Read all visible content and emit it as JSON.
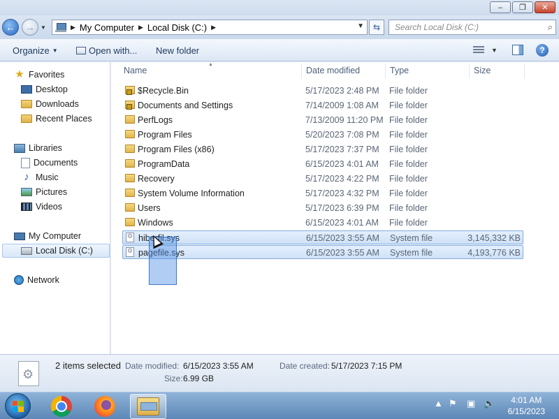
{
  "window": {
    "minimize_glyph": "–",
    "maximize_glyph": "❐",
    "close_glyph": "✕"
  },
  "address": {
    "crumbs": [
      "My Computer",
      "Local Disk (C:)"
    ],
    "search_placeholder": "Search Local Disk (C:)"
  },
  "toolbar": {
    "organize": "Organize",
    "open_with": "Open with...",
    "new_folder": "New folder"
  },
  "nav": {
    "favorites": "Favorites",
    "desktop": "Desktop",
    "downloads": "Downloads",
    "recent_places": "Recent Places",
    "libraries": "Libraries",
    "documents": "Documents",
    "music": "Music",
    "pictures": "Pictures",
    "videos": "Videos",
    "my_computer": "My Computer",
    "local_disk": "Local Disk (C:)",
    "network": "Network"
  },
  "columns": {
    "name": "Name",
    "date_modified": "Date modified",
    "type": "Type",
    "size": "Size"
  },
  "files": [
    {
      "name": "$Recycle.Bin",
      "date": "5/17/2023 2:48 PM",
      "type": "File folder",
      "size": "",
      "icon": "locked-folder",
      "selected": false
    },
    {
      "name": "Documents and Settings",
      "date": "7/14/2009 1:08 AM",
      "type": "File folder",
      "size": "",
      "icon": "locked-folder",
      "selected": false
    },
    {
      "name": "PerfLogs",
      "date": "7/13/2009 11:20 PM",
      "type": "File folder",
      "size": "",
      "icon": "folder",
      "selected": false
    },
    {
      "name": "Program Files",
      "date": "5/20/2023 7:08 PM",
      "type": "File folder",
      "size": "",
      "icon": "folder",
      "selected": false
    },
    {
      "name": "Program Files (x86)",
      "date": "5/17/2023 7:37 PM",
      "type": "File folder",
      "size": "",
      "icon": "folder",
      "selected": false
    },
    {
      "name": "ProgramData",
      "date": "6/15/2023 4:01 AM",
      "type": "File folder",
      "size": "",
      "icon": "folder",
      "selected": false
    },
    {
      "name": "Recovery",
      "date": "5/17/2023 4:22 PM",
      "type": "File folder",
      "size": "",
      "icon": "folder",
      "selected": false
    },
    {
      "name": "System Volume Information",
      "date": "5/17/2023 4:32 PM",
      "type": "File folder",
      "size": "",
      "icon": "folder",
      "selected": false
    },
    {
      "name": "Users",
      "date": "5/17/2023 6:39 PM",
      "type": "File folder",
      "size": "",
      "icon": "folder",
      "selected": false
    },
    {
      "name": "Windows",
      "date": "6/15/2023 4:01 AM",
      "type": "File folder",
      "size": "",
      "icon": "folder",
      "selected": false
    },
    {
      "name": "hiberfil.sys",
      "date": "6/15/2023 3:55 AM",
      "type": "System file",
      "size": "3,145,332 KB",
      "icon": "system-file",
      "selected": true
    },
    {
      "name": "pagefile.sys",
      "date": "6/15/2023 3:55 AM",
      "type": "System file",
      "size": "4,193,776 KB",
      "icon": "system-file",
      "selected": true
    }
  ],
  "details": {
    "count_text": "2 items selected",
    "date_modified_label": "Date modified:",
    "date_modified_value": "6/15/2023 3:55 AM",
    "date_created_label": "Date created:",
    "date_created_value": "5/17/2023 7:15 PM",
    "size_label": "Size:",
    "size_value": "6.99 GB"
  },
  "taskbar": {
    "time": "4:01 AM",
    "date": "6/15/2023",
    "tray_show_hidden": "▲"
  },
  "colors": {
    "selection": "#cfe2f8",
    "selection_border": "#84acdd",
    "accent": "#1e395b"
  }
}
